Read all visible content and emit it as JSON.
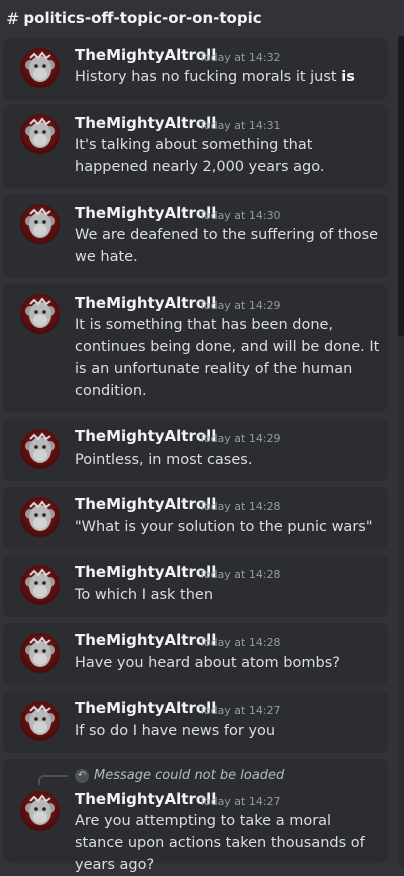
{
  "channel": {
    "hash": "#",
    "name": "politics-off-topic-or-on-topic"
  },
  "messages": [
    {
      "author": "TheMightyAltroll",
      "time": "Today at 14:32",
      "text_before": "History has no fucking morals it just ",
      "text_bold": "is"
    },
    {
      "author": "TheMightyAltroll",
      "time": "Today at 14:31",
      "text": "It's talking about something that happened nearly 2,000 years ago."
    },
    {
      "author": "TheMightyAltroll",
      "time": "Today at 14:30",
      "text": "We are deafened to the suffering of those we hate."
    },
    {
      "author": "TheMightyAltroll",
      "time": "Today at 14:29",
      "text": "It is something that has been done, continues being done, and will be done. It is an unfortunate reality of the human condition."
    },
    {
      "author": "TheMightyAltroll",
      "time": "Today at 14:29",
      "text": "Pointless, in most cases."
    },
    {
      "author": "TheMightyAltroll",
      "time": "Today at 14:28",
      "text": "\"What is your solution to the punic wars\""
    },
    {
      "author": "TheMightyAltroll",
      "time": "Today at 14:28",
      "text": "To which I ask then"
    },
    {
      "author": "TheMightyAltroll",
      "time": "Today at 14:28",
      "text": "Have you heard about atom bombs?"
    },
    {
      "author": "TheMightyAltroll",
      "time": "Today at 14:27",
      "text": "If so do I have news for you"
    },
    {
      "author": "TheMightyAltroll",
      "time": "Today at 14:27",
      "reply": "Message could not be loaded",
      "text": "Are you attempting to take a moral stance upon actions taken thousands of years ago?"
    }
  ],
  "icons": {
    "reply": "reply-arrow-icon",
    "avatar": "monkey-avatar-icon"
  },
  "colors": {
    "background": "#313338",
    "card": "#2b2d31",
    "username": "#f2f3f5",
    "timestamp": "#949ba4",
    "text": "#dbdee1",
    "avatar_bg": "#7a1a1a"
  }
}
